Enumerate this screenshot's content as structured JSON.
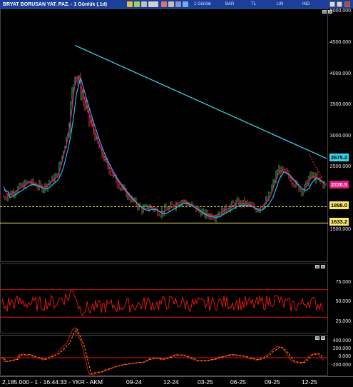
{
  "window": {
    "title": "BRYAT BORUSAN YAT. PAZ. - 1 Günlük (.1d)",
    "toolbar": {
      "period_label": "1 Günlük",
      "bar_label": "BAR",
      "tl_label": "TL",
      "lin_label": "LIN",
      "ind_label": "IND"
    }
  },
  "price_chart": {
    "y_axis_labels": [
      "5000.000",
      "4500.000",
      "4000.000",
      "3500.000",
      "3000.000",
      "2500.000",
      "1500.000"
    ],
    "markers": [
      {
        "value": "2675.2",
        "color": "#39d4e8"
      },
      {
        "value": "2220.5",
        "color": "#e8157b"
      },
      {
        "value": "1898.0",
        "color": "#f7e66a"
      },
      {
        "value": "1633.2",
        "color": "#f7e66a"
      }
    ]
  },
  "rsi_panel": {
    "y_axis_labels": [
      "75.000",
      "50.000",
      "25.000"
    ]
  },
  "osc_panel": {
    "y_axis_labels": [
      "400.000",
      "200.000",
      "0.000",
      "-200.000"
    ]
  },
  "status_bar": {
    "text": "2,185.000 - 1 - 16:44:33 - YKR - AKM",
    "x_labels": [
      "09-24",
      "12-24",
      "03-25",
      "06-25",
      "09-25",
      "12-25"
    ]
  },
  "colors": {
    "trendline": "#39d4e8",
    "ma_fast": "#e8157b",
    "ma_slow": "#2fb6e6",
    "rsi": "#e01515",
    "osc": "#ffa500"
  }
}
